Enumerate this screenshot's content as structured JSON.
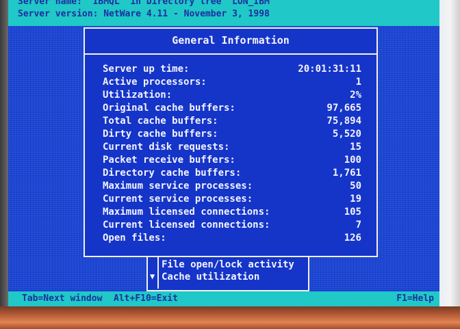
{
  "header": {
    "server_name_line": "Server name: 'IBMQL' in Directory tree 'LON_IBM'",
    "server_version_line": "Server version: NetWare 4.11 - November 3, 1998"
  },
  "panel": {
    "title": "General Information",
    "stats": [
      {
        "label": "Server up time:",
        "value": "20:01:31:11"
      },
      {
        "label": "Active processors:",
        "value": "1"
      },
      {
        "label": "Utilization:",
        "value": "2%"
      },
      {
        "label": "Original cache buffers:",
        "value": "97,665"
      },
      {
        "label": "Total cache buffers:",
        "value": "75,894"
      },
      {
        "label": "Dirty cache buffers:",
        "value": "5,520"
      },
      {
        "label": "Current disk requests:",
        "value": "15"
      },
      {
        "label": "Packet receive buffers:",
        "value": "100"
      },
      {
        "label": "Directory cache buffers:",
        "value": "1,761"
      },
      {
        "label": "Maximum service processes:",
        "value": "50"
      },
      {
        "label": "Current service processes:",
        "value": "19"
      },
      {
        "label": "Maximum licensed connections:",
        "value": "105"
      },
      {
        "label": "Current licensed connections:",
        "value": "7"
      },
      {
        "label": "Open files:",
        "value": "126"
      }
    ]
  },
  "options": {
    "items": [
      "File open/lock activity",
      "Cache utilization"
    ],
    "scroll_indicator": "▼"
  },
  "status_bar": {
    "left": "Tab=Next window",
    "middle": "Alt+F10=Exit",
    "right": "F1=Help"
  },
  "colors": {
    "screen_blue": "#1a3fd0",
    "cyan_bar": "#20c8c8",
    "text_dark_blue": "#1c2f9e",
    "text_white": "#f4f4ff"
  }
}
